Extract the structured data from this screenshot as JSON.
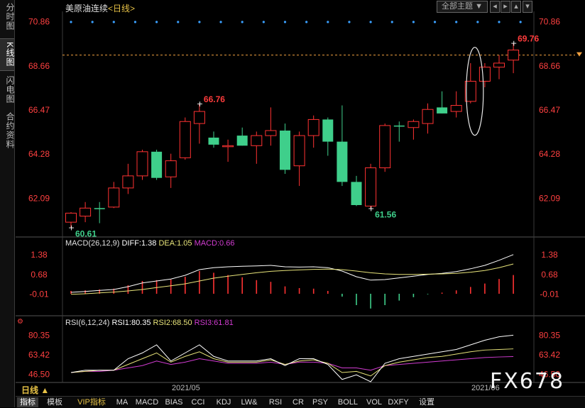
{
  "title": {
    "instrument": "美原油连续",
    "period": "<日线>"
  },
  "side_tabs": [
    {
      "label": "分时图",
      "active": false
    },
    {
      "label": "K线图",
      "active": true
    },
    {
      "label": "闪电图",
      "active": false
    },
    {
      "label": "合约资料",
      "active": false
    }
  ],
  "top_buttons": {
    "theme": "全部主题",
    "icons": [
      "arrow-left-icon",
      "arrow-right-icon",
      "arrow-up-icon",
      "arrow-down-icon"
    ]
  },
  "period_selector": "日线 ▲",
  "date_labels": [
    "2021/05",
    "2021/06"
  ],
  "bottom_tabs": [
    {
      "label": "指标",
      "active": true
    },
    {
      "label": "模板"
    },
    {
      "label": "VIP指标",
      "vip": true
    },
    {
      "label": "MA"
    },
    {
      "label": "MACD"
    },
    {
      "label": "BIAS"
    },
    {
      "label": "CCI"
    },
    {
      "label": "KDJ"
    },
    {
      "label": "LW&"
    },
    {
      "label": "RSI"
    },
    {
      "label": "CR"
    },
    {
      "label": "PSY"
    },
    {
      "label": "BOLL"
    },
    {
      "label": "VOL"
    },
    {
      "label": "DXFY"
    },
    {
      "label": "设置"
    }
  ],
  "watermark": "FX678",
  "colors": {
    "up": "#ff3232",
    "down": "#3fcf8b",
    "macd_white": "#ffffff",
    "dea_yellow": "#e8e47a",
    "macd_magenta": "#d23cd2",
    "rsi2_yellow": "#e8e47a",
    "rsi3_magenta": "#d23cd2",
    "dashed_price": "#f0a040"
  },
  "chart_data": [
    {
      "type": "candlestick",
      "name": "price",
      "y_ticks": [
        "70.86",
        "68.66",
        "66.47",
        "64.28",
        "62.09"
      ],
      "ylim": [
        60.2,
        71.3
      ],
      "current_price_line": 69.2,
      "annotations": [
        {
          "label": "69.76",
          "index": 31,
          "value": 69.76,
          "color": "#ff3c3c"
        },
        {
          "label": "66.76",
          "index": 9,
          "value": 66.76,
          "color": "#ff3c3c"
        },
        {
          "label": "61.56",
          "index": 21,
          "value": 61.56,
          "color": "#3fcf8b"
        },
        {
          "label": "60.61",
          "index": 0,
          "value": 60.61,
          "color": "#3fcf8b"
        }
      ],
      "candles": [
        {
          "o": 60.9,
          "h": 61.4,
          "l": 60.61,
          "c": 61.35
        },
        {
          "o": 61.2,
          "h": 61.9,
          "l": 60.9,
          "c": 61.6
        },
        {
          "o": 61.6,
          "h": 61.9,
          "l": 60.85,
          "c": 61.55
        },
        {
          "o": 61.65,
          "h": 62.9,
          "l": 61.6,
          "c": 62.6
        },
        {
          "o": 62.6,
          "h": 63.8,
          "l": 62.3,
          "c": 63.2
        },
        {
          "o": 63.2,
          "h": 64.5,
          "l": 63.0,
          "c": 64.4
        },
        {
          "o": 64.4,
          "h": 64.5,
          "l": 63.0,
          "c": 63.1
        },
        {
          "o": 63.15,
          "h": 64.3,
          "l": 62.6,
          "c": 63.95
        },
        {
          "o": 64.1,
          "h": 66.1,
          "l": 64.0,
          "c": 65.9
        },
        {
          "o": 65.8,
          "h": 66.76,
          "l": 64.8,
          "c": 66.4
        },
        {
          "o": 65.1,
          "h": 65.4,
          "l": 64.6,
          "c": 64.75
        },
        {
          "o": 64.7,
          "h": 65.0,
          "l": 63.9,
          "c": 64.7
        },
        {
          "o": 65.2,
          "h": 65.6,
          "l": 64.7,
          "c": 64.7
        },
        {
          "o": 64.7,
          "h": 65.4,
          "l": 63.8,
          "c": 65.2
        },
        {
          "o": 65.2,
          "h": 66.6,
          "l": 64.7,
          "c": 65.45
        },
        {
          "o": 65.45,
          "h": 65.8,
          "l": 63.3,
          "c": 63.5
        },
        {
          "o": 63.7,
          "h": 65.4,
          "l": 62.7,
          "c": 65.2
        },
        {
          "o": 65.2,
          "h": 66.2,
          "l": 64.6,
          "c": 66.0
        },
        {
          "o": 66.0,
          "h": 66.1,
          "l": 64.2,
          "c": 64.9
        },
        {
          "o": 64.9,
          "h": 66.7,
          "l": 62.7,
          "c": 62.9
        },
        {
          "o": 62.9,
          "h": 63.2,
          "l": 61.7,
          "c": 61.75
        },
        {
          "o": 61.7,
          "h": 63.8,
          "l": 61.56,
          "c": 63.6
        },
        {
          "o": 63.6,
          "h": 65.8,
          "l": 63.4,
          "c": 65.7
        },
        {
          "o": 65.7,
          "h": 65.9,
          "l": 64.9,
          "c": 65.65
        },
        {
          "o": 65.6,
          "h": 66.0,
          "l": 65.0,
          "c": 65.9
        },
        {
          "o": 65.8,
          "h": 66.8,
          "l": 65.3,
          "c": 66.5
        },
        {
          "o": 66.6,
          "h": 67.4,
          "l": 66.3,
          "c": 66.3
        },
        {
          "o": 66.4,
          "h": 67.4,
          "l": 66.1,
          "c": 66.7
        },
        {
          "o": 66.9,
          "h": 68.8,
          "l": 66.8,
          "c": 67.9
        },
        {
          "o": 67.9,
          "h": 68.8,
          "l": 67.6,
          "c": 68.6
        },
        {
          "o": 68.6,
          "h": 69.2,
          "l": 68.0,
          "c": 68.8
        },
        {
          "o": 68.95,
          "h": 69.76,
          "l": 68.3,
          "c": 69.45
        }
      ]
    },
    {
      "type": "line",
      "name": "MACD(26,12,9)",
      "legend": [
        {
          "text": "MACD(26,12,9)",
          "color": "#e0e0e0"
        },
        {
          "text": "DIFF:1.38",
          "color": "#ffffff"
        },
        {
          "text": "DEA:1.05",
          "color": "#e8e47a"
        },
        {
          "text": "MACD:0.66",
          "color": "#d23cd2"
        }
      ],
      "y_ticks": [
        "1.38",
        "0.68",
        "-0.01"
      ],
      "ylim": [
        -0.75,
        1.6
      ],
      "series": [
        {
          "name": "DIFF",
          "values": [
            0.05,
            0.08,
            0.12,
            0.15,
            0.25,
            0.38,
            0.45,
            0.52,
            0.65,
            0.85,
            0.92,
            0.95,
            0.97,
            0.98,
            1.0,
            0.95,
            0.94,
            0.95,
            0.92,
            0.8,
            0.6,
            0.48,
            0.5,
            0.56,
            0.62,
            0.68,
            0.72,
            0.78,
            0.88,
            1.0,
            1.18,
            1.38
          ]
        },
        {
          "name": "DEA",
          "values": [
            -0.02,
            0.0,
            0.03,
            0.06,
            0.1,
            0.15,
            0.22,
            0.28,
            0.35,
            0.45,
            0.55,
            0.62,
            0.68,
            0.74,
            0.79,
            0.82,
            0.84,
            0.86,
            0.87,
            0.85,
            0.8,
            0.74,
            0.7,
            0.68,
            0.68,
            0.69,
            0.7,
            0.72,
            0.76,
            0.82,
            0.92,
            1.05
          ]
        },
        {
          "name": "MACD",
          "values": [
            0.1,
            0.12,
            0.15,
            0.18,
            0.3,
            0.45,
            0.48,
            0.5,
            0.6,
            0.8,
            0.74,
            0.66,
            0.58,
            0.48,
            0.42,
            0.26,
            0.2,
            0.18,
            0.1,
            -0.1,
            -0.4,
            -0.52,
            -0.4,
            -0.24,
            -0.12,
            -0.02,
            0.04,
            0.12,
            0.24,
            0.36,
            0.52,
            0.66
          ]
        }
      ]
    },
    {
      "type": "line",
      "name": "RSI(6,12,24)",
      "legend": [
        {
          "text": "RSI(6,12,24)",
          "color": "#e0e0e0"
        },
        {
          "text": "RSI1:80.35",
          "color": "#ffffff"
        },
        {
          "text": "RSI2:68.50",
          "color": "#e8e47a"
        },
        {
          "text": "RSI3:61.81",
          "color": "#d23cd2"
        }
      ],
      "y_ticks": [
        "80.35",
        "63.42",
        "46.50"
      ],
      "ylim": [
        40,
        88
      ],
      "series": [
        {
          "name": "RSI1",
          "values": [
            48,
            50,
            50,
            50,
            60,
            65,
            72,
            58,
            65,
            72,
            62,
            58,
            58,
            58,
            60,
            54,
            60,
            60,
            55,
            42,
            46,
            40,
            56,
            60,
            62,
            64,
            66,
            68,
            72,
            76,
            79,
            80.35
          ]
        },
        {
          "name": "RSI2",
          "values": [
            48,
            49,
            50,
            50,
            55,
            60,
            65,
            57,
            62,
            66,
            60,
            57,
            57,
            57,
            59,
            55,
            58,
            59,
            56,
            48,
            49,
            45,
            54,
            57,
            59,
            61,
            62,
            64,
            66,
            67.5,
            68,
            68.5
          ]
        },
        {
          "name": "RSI3",
          "values": [
            48,
            49,
            49,
            50,
            52,
            54,
            58,
            55,
            57,
            60,
            58,
            56,
            56,
            56,
            57,
            55,
            57,
            57,
            56,
            52,
            52,
            50,
            54,
            55,
            56,
            57,
            58,
            59,
            60,
            61,
            61.5,
            61.81
          ]
        }
      ]
    }
  ]
}
